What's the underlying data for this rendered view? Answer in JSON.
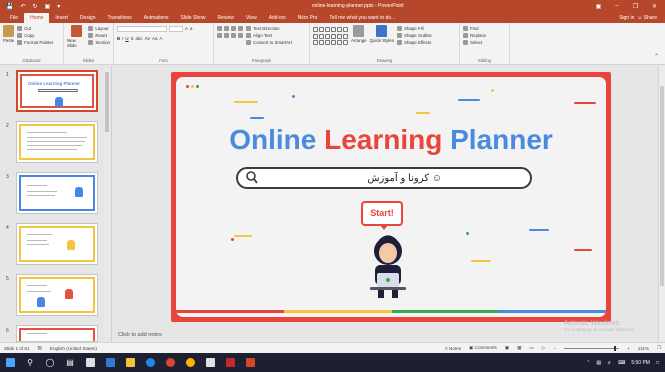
{
  "window": {
    "title": "online-learning-planner.pptx - PowerPoint",
    "quick_access": [
      "save",
      "undo",
      "redo",
      "start-from-beginning",
      "customize"
    ]
  },
  "tabs": [
    {
      "label": "File",
      "active": false
    },
    {
      "label": "Home",
      "active": true
    },
    {
      "label": "Insert",
      "active": false
    },
    {
      "label": "Design",
      "active": false
    },
    {
      "label": "Transitions",
      "active": false
    },
    {
      "label": "Animations",
      "active": false
    },
    {
      "label": "Slide Show",
      "active": false
    },
    {
      "label": "Review",
      "active": false
    },
    {
      "label": "View",
      "active": false
    },
    {
      "label": "Add-ins",
      "active": false
    },
    {
      "label": "Nitro Pro",
      "active": false
    },
    {
      "label": "Tell me what you want to do...",
      "active": false
    }
  ],
  "signin": "Sign in",
  "share": "Share",
  "ribbon": {
    "clipboard": {
      "label": "Clipboard",
      "paste": "Paste",
      "cut": "Cut",
      "copy": "Copy",
      "format_painter": "Format Painter"
    },
    "slides": {
      "label": "Slides",
      "new_slide": "New Slide",
      "layout": "Layout",
      "reset": "Reset",
      "section": "Section"
    },
    "font": {
      "label": "Font"
    },
    "paragraph": {
      "label": "Paragraph",
      "text_direction": "Text Direction",
      "align_text": "Align Text",
      "convert_smartart": "Convert to SmartArt"
    },
    "drawing": {
      "label": "Drawing",
      "arrange": "Arrange",
      "quick_styles": "Quick Styles",
      "shape_fill": "Shape Fill",
      "shape_outline": "Shape Outline",
      "shape_effects": "Shape Effects"
    },
    "editing": {
      "label": "Editing",
      "find": "Find",
      "replace": "Replace",
      "select": "Select"
    }
  },
  "thumbnails": [
    {
      "num": "1",
      "title": "Online Learning Planner",
      "selected": true
    },
    {
      "num": "2",
      "title": "",
      "selected": false
    },
    {
      "num": "3",
      "title": "",
      "selected": false
    },
    {
      "num": "4",
      "title": "",
      "selected": false
    },
    {
      "num": "5",
      "title": "",
      "selected": false
    },
    {
      "num": "6",
      "title": "",
      "selected": false
    }
  ],
  "slide": {
    "title_words": [
      "Online",
      "Learning",
      "Planner"
    ],
    "title_colors": [
      "#4a8be0",
      "#e8453c",
      "#4a8be0"
    ],
    "search_text": "کرونا و آموزش ☺",
    "start_label": "Start!"
  },
  "notes_placeholder": "Click to add notes",
  "activate": {
    "line1": "Activate Windows",
    "line2": "Go to Settings to activate Windows."
  },
  "status": {
    "slide_of": "Slide 1 of 61",
    "language": "English (United States)",
    "notes": "Notes",
    "comments": "Comments",
    "zoom": "111%"
  },
  "taskbar": {
    "time": "5:50 PM"
  },
  "colors": {
    "ppt_red": "#b7472a",
    "slide_border": "#e8453c",
    "title_blue": "#4a8be0",
    "accent_yellow": "#f4c542",
    "accent_green": "#34a853"
  }
}
